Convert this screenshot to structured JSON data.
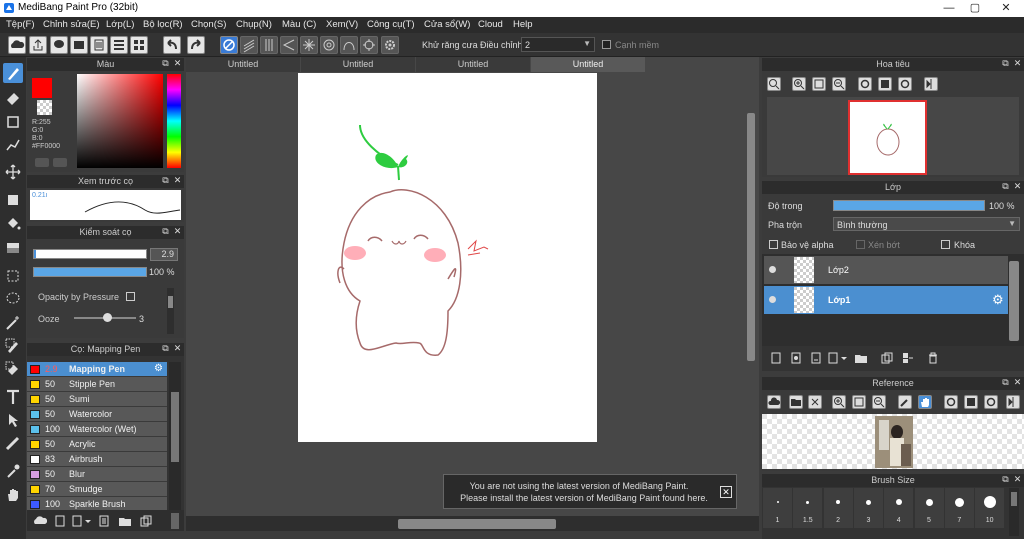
{
  "app": {
    "title": "MediBang Paint Pro (32bit)"
  },
  "window_controls": {
    "minimize": "—",
    "maximize": "▢",
    "close": "✕"
  },
  "menu": [
    "Tệp(F)",
    "Chỉnh sửa(E)",
    "Lớp(L)",
    "Bộ lọc(R)",
    "Chọn(S)",
    "Chụp(N)",
    "Màu (C)",
    "Xem(V)",
    "Công cụ(T)",
    "Cửa sổ(W)",
    "Cloud",
    "Help"
  ],
  "toolbar": {
    "antialias_label": "Khử răng cưa",
    "correction_label": "Điều chỉnh",
    "correction_value": "2",
    "edge_label": "Cạnh mềm"
  },
  "color_panel": {
    "title": "Màu",
    "readout": [
      "R:255",
      "G:0",
      "B:0",
      "#FF0000"
    ],
    "primary_color": "#ff0000"
  },
  "brush_preview": {
    "title": "Xem trước cọ",
    "size_label": "0.21ı"
  },
  "brush_control": {
    "title": "Kiểm soát cọ",
    "size_value": "2.9",
    "opacity_value": "100 %",
    "opacity_fill": 1.0,
    "pressure_label": "Opacity by Pressure",
    "ooze_label": "Ooze",
    "ooze_value": "3"
  },
  "brush_list": {
    "title": "Cọ: Mapping Pen",
    "items": [
      {
        "size": "2.9",
        "name": "Mapping Pen",
        "color": "#ff0000",
        "selected": true
      },
      {
        "size": "50",
        "name": "Stipple Pen",
        "color": "#ffd400",
        "selected": false
      },
      {
        "size": "50",
        "name": "Sumi",
        "color": "#ffd400",
        "selected": false
      },
      {
        "size": "50",
        "name": "Watercolor",
        "color": "#5bc0eb",
        "selected": false
      },
      {
        "size": "100",
        "name": "Watercolor (Wet)",
        "color": "#5bc0eb",
        "selected": false
      },
      {
        "size": "50",
        "name": "Acrylic",
        "color": "#ffd400",
        "selected": false
      },
      {
        "size": "83",
        "name": "Airbrush",
        "color": "#ffffff",
        "selected": false
      },
      {
        "size": "50",
        "name": "Blur",
        "color": "#d59ee0",
        "selected": false
      },
      {
        "size": "70",
        "name": "Smudge",
        "color": "#ffd400",
        "selected": false
      },
      {
        "size": "100",
        "name": "Sparkle Brush",
        "color": "#3d5afe",
        "selected": false
      }
    ]
  },
  "tabs": [
    "Untitled",
    "Untitled",
    "Untitled",
    "Untitled"
  ],
  "notification": {
    "line1": "You are not using the latest version of MediBang Paint.",
    "line2": "Please install the latest version of MediBang Paint found here."
  },
  "navigator": {
    "title": "Hoa tiêu"
  },
  "layers": {
    "title": "Lớp",
    "opacity_label": "Độ trong",
    "opacity_value": "100 %",
    "opacity_fill": 1.0,
    "blend_label": "Pha trộn",
    "blend_value": "Bình thường",
    "protect_alpha": "Bảo vệ alpha",
    "clipping": "Xén bớt",
    "lock": "Khóa",
    "items": [
      {
        "name": "Lớp2",
        "selected": false
      },
      {
        "name": "Lớp1",
        "selected": true
      }
    ]
  },
  "reference": {
    "title": "Reference"
  },
  "brush_size": {
    "title": "Brush Size",
    "sizes": [
      "1",
      "1.5",
      "2",
      "3",
      "4",
      "5",
      "7",
      "10"
    ]
  }
}
